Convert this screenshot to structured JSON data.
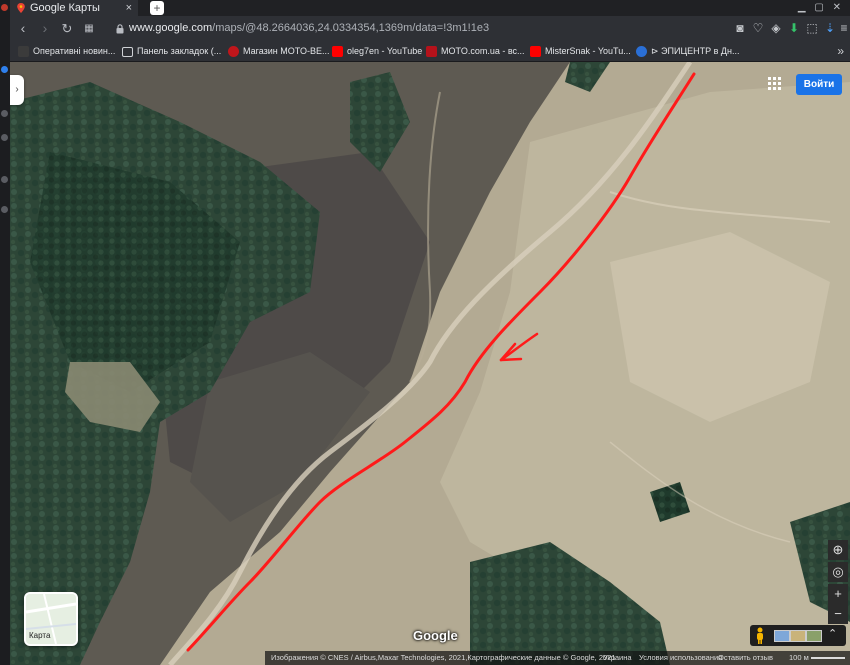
{
  "browser": {
    "tab_title": "Google Карты",
    "url_host": "www.google.com",
    "url_path": "/maps/@48.2664036,24.0334354,1369m/data=!3m1!1e3"
  },
  "bookmarks": [
    {
      "label": "Оперативні новин...",
      "icon_color": "#3b3b3b",
      "icon": "unian-icon"
    },
    {
      "label": "Панель закладок (...",
      "icon_color": "#2e3035",
      "icon": "folder-icon"
    },
    {
      "label": "Магазин MOTO-BE...",
      "icon_color": "#c0161b",
      "icon": "moto-be-icon"
    },
    {
      "label": "oleg7en - YouTube",
      "icon_color": "#ff0000",
      "icon": "youtube-icon"
    },
    {
      "label": "MOTO.com.ua - вс...",
      "icon_color": "#b5121b",
      "icon": "moto-com-icon"
    },
    {
      "label": "MisterSnak - YouTu...",
      "icon_color": "#ff0000",
      "icon": "youtube-icon"
    },
    {
      "label": "ЭПИЦЕНТР в Дн...",
      "icon_color": "#2a6fd6",
      "icon": "epicentr-icon"
    }
  ],
  "map": {
    "login_label": "Войти",
    "layer_label": "Карта",
    "google_logo": "Google",
    "footer": {
      "imagery": "Изображения © CNES / Airbus,Maxar Technologies, 2021,Картографические данные © Google, 2021",
      "country": "Украина",
      "terms": "Условия использования",
      "feedback": "Оставить отзыв",
      "scale": "100 м"
    },
    "colors": {
      "route": "#ff1a1a",
      "forest": "#2d4637",
      "field": "#a89f89",
      "button_blue": "#1a73e8"
    }
  }
}
